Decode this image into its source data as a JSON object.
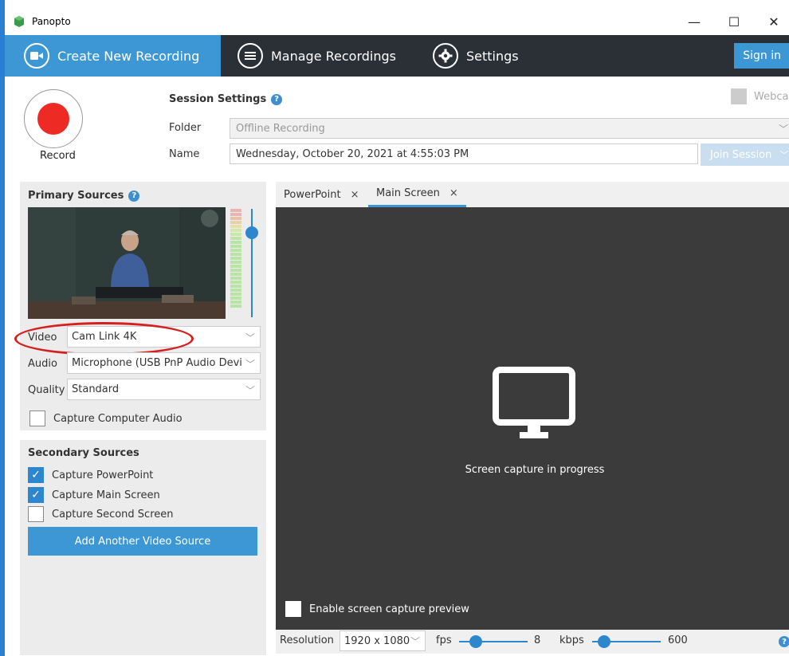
{
  "window": {
    "title": "Panopto",
    "minimize": "—",
    "maximize": "☐",
    "close": "✕"
  },
  "nav": {
    "create": "Create New Recording",
    "manage": "Manage Recordings",
    "settings": "Settings",
    "signin": "Sign in"
  },
  "header": {
    "record_label": "Record",
    "session_settings": "Session Settings",
    "folder_label": "Folder",
    "folder_value": "Offline Recording",
    "name_label": "Name",
    "name_value": "Wednesday, October 20, 2021 at 4:55:03 PM",
    "join_session": "Join Session",
    "webcast": "Webcast"
  },
  "primary": {
    "title": "Primary Sources",
    "video_label": "Video",
    "video_value": "Cam Link 4K",
    "audio_label": "Audio",
    "audio_value": "Microphone (USB PnP Audio Devi",
    "quality_label": "Quality",
    "quality_value": "Standard",
    "capture_audio": "Capture Computer Audio"
  },
  "secondary": {
    "title": "Secondary Sources",
    "items": [
      {
        "label": "Capture PowerPoint",
        "checked": true
      },
      {
        "label": "Capture Main Screen",
        "checked": true
      },
      {
        "label": "Capture Second Screen",
        "checked": false
      }
    ],
    "add_button": "Add Another Video Source"
  },
  "tabs": [
    {
      "label": "PowerPoint",
      "close": "×"
    },
    {
      "label": "Main Screen",
      "close": "×"
    }
  ],
  "preview": {
    "status": "Screen capture in progress",
    "enable_preview": "Enable screen capture preview"
  },
  "bottom": {
    "resolution_label": "Resolution",
    "resolution_value": "1920 x 1080",
    "fps_label": "fps",
    "fps_value": "8",
    "kbps_label": "kbps",
    "kbps_value": "600"
  },
  "colors": {
    "accent": "#3d97d4",
    "navbar": "#2b2f36",
    "record": "#ee2a24",
    "preview_bg": "#3b3b3b",
    "annotation": "#d42020"
  }
}
